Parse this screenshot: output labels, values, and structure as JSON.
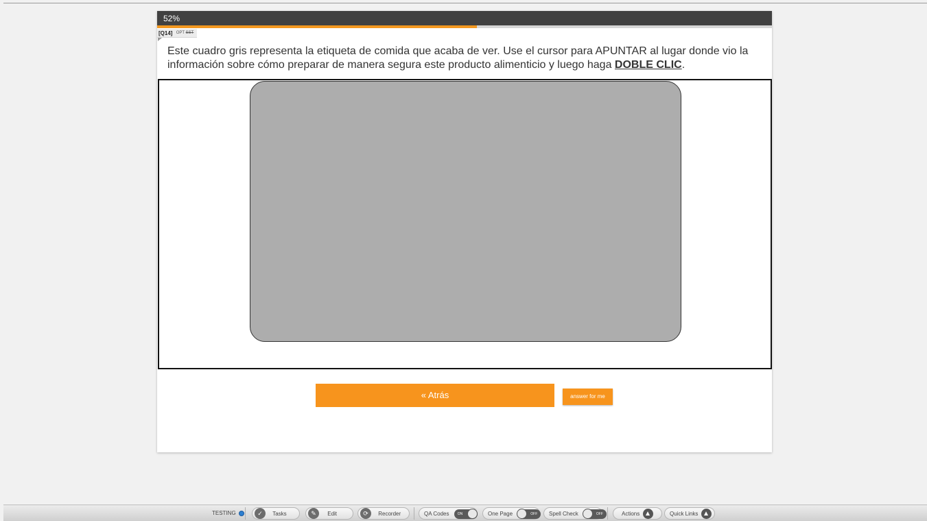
{
  "progress": {
    "label": "52%",
    "fraction": 0.52
  },
  "question": {
    "id": "[Q14]",
    "opt": "OPT",
    "sst": "SST",
    "text_before": "Este cuadro gris representa la etiqueta de comida que acaba de ver. Use el cursor para APUNTAR al lugar donde vio la información sobre cómo preparar de manera segura este producto alimenticio y luego haga ",
    "emphasis": "DOBLE CLIC",
    "text_after": "."
  },
  "buttons": {
    "back": "« Atrás",
    "answer_for_me": "answer for me"
  },
  "toolbar": {
    "testing": "TESTING",
    "tasks": "Tasks",
    "edit": "Edit",
    "recorder": "Recorder",
    "qa_codes": "QA Codes",
    "qa_codes_state": "ON",
    "one_page": "One Page",
    "one_page_state": "OFF",
    "spell_check": "Spell Check",
    "spell_check_state": "OFF",
    "actions": "Actions",
    "quick_links": "Quick Links"
  },
  "colors": {
    "accent": "#f7941d",
    "header": "#414141",
    "box": "#adadad"
  }
}
